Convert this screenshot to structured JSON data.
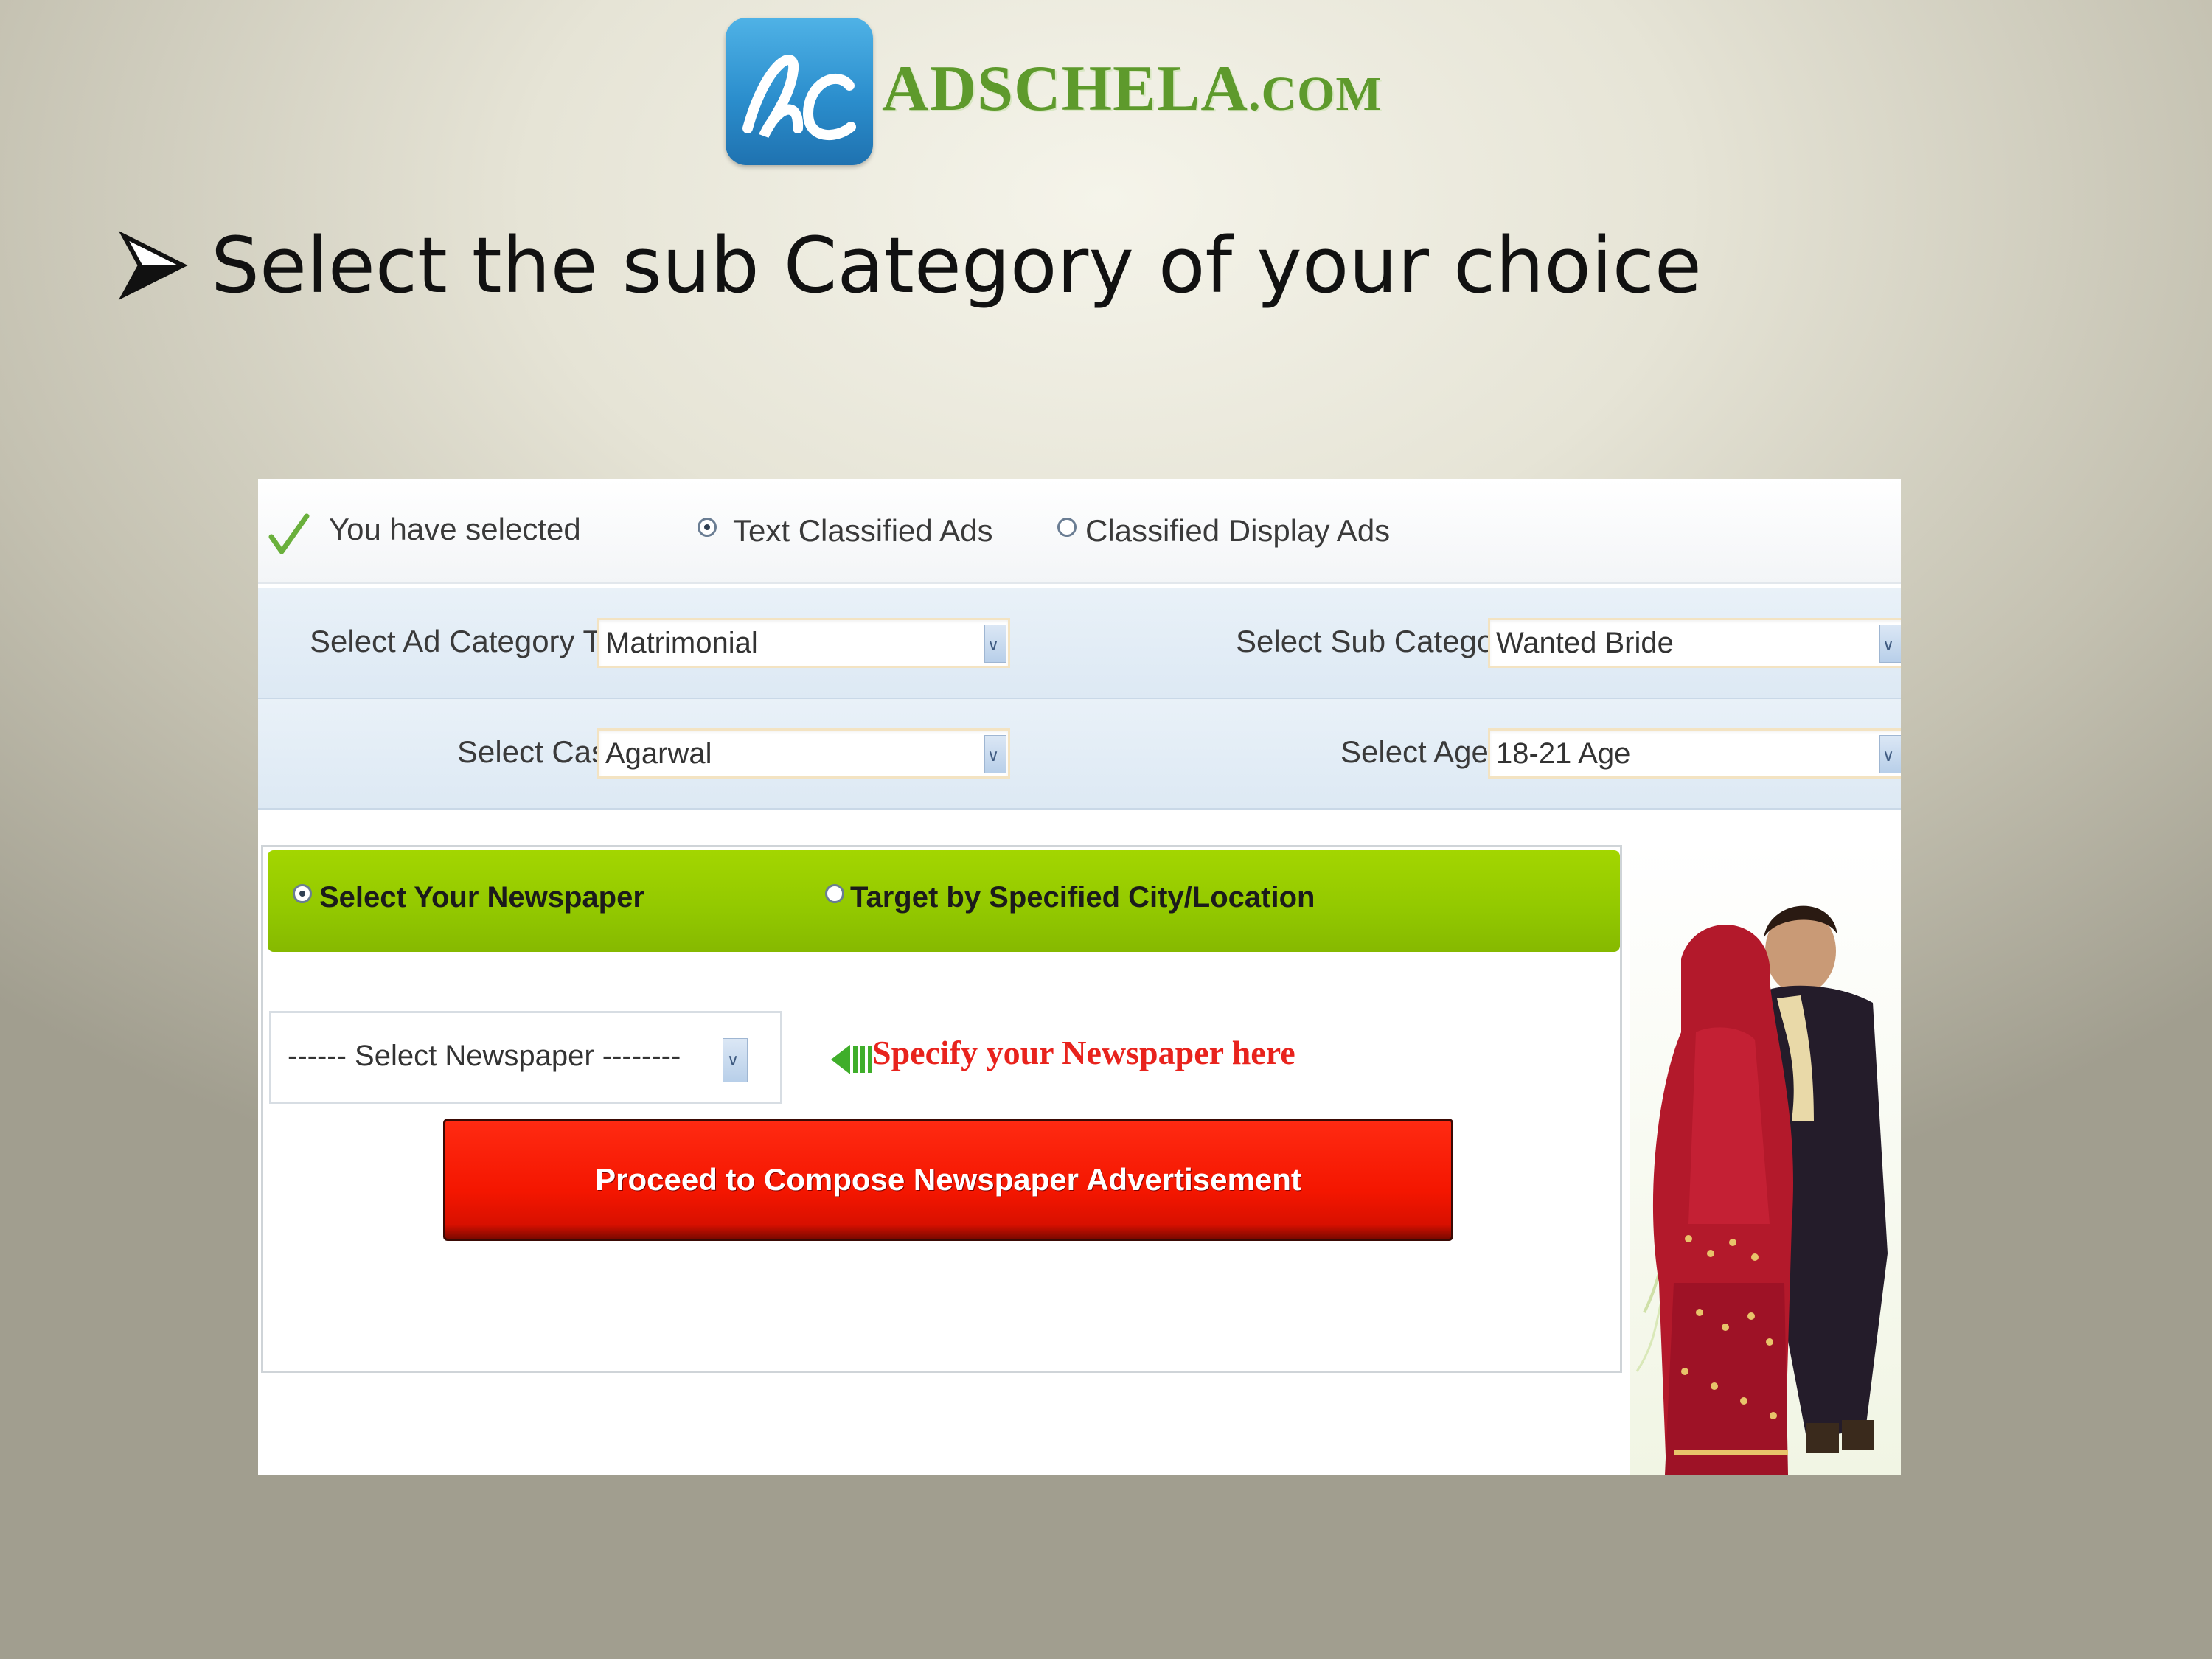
{
  "logo": {
    "mark_letters": "ac",
    "name": "ADSCHELA",
    "tld": ".COM"
  },
  "heading": {
    "bullet_icon": "arrow-bullet-icon",
    "text": "Select the sub Category of your choice"
  },
  "form": {
    "selection_label": "You have selected",
    "ad_types": [
      {
        "label": "Text Classified Ads",
        "selected": true
      },
      {
        "label": "Classified Display Ads",
        "selected": false
      }
    ],
    "ad_category": {
      "label": "Select Ad Category Type :",
      "value": "Matrimonial"
    },
    "sub_category": {
      "label": "Select Sub Category :",
      "value": "Wanted Bride"
    },
    "cast": {
      "label": "Select Cast :",
      "value": "Agarwal"
    },
    "age": {
      "label": "Select Age :",
      "value": "18-21 Age"
    },
    "targeting": [
      {
        "label": "Select Your Newspaper",
        "selected": true
      },
      {
        "label": "Target by Specified City/Location",
        "selected": false
      }
    ],
    "newspaper": {
      "value": "------ Select Newspaper --------"
    },
    "newspaper_hint": "Specify your Newspaper here",
    "proceed_button": "Proceed to Compose Newspaper Advertisement"
  },
  "colors": {
    "logo_blue": "#2b8ecd",
    "logo_green": "#5e9a2c",
    "green_bar": "#92c800",
    "proceed_red": "#f41600",
    "hint_red": "#e8231d"
  }
}
